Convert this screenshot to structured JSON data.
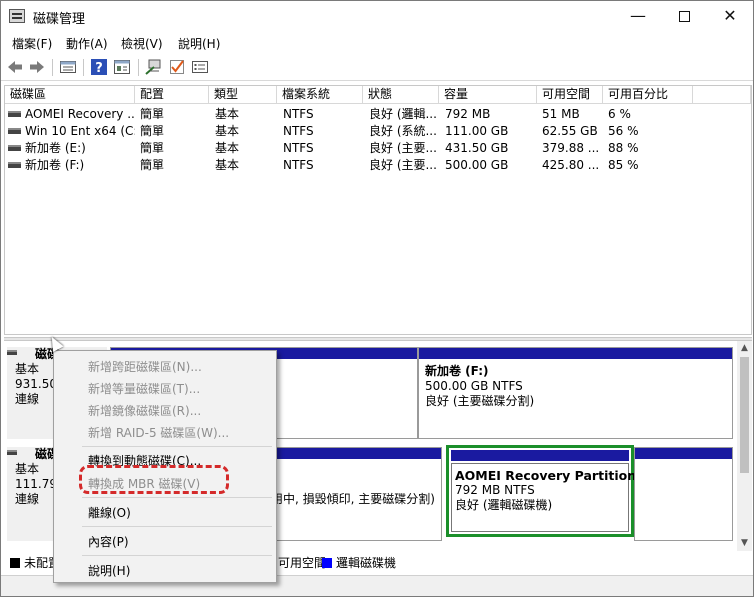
{
  "window": {
    "title": "磁碟管理",
    "minimize": "—",
    "close": "✕"
  },
  "menu": {
    "file": "檔案(F)",
    "action": "動作(A)",
    "view": "檢視(V)",
    "help": "說明(H)"
  },
  "toolbar": {
    "icons": [
      "back-icon",
      "forward-icon",
      "disk-list-icon",
      "help-icon",
      "properties-icon",
      "connect-icon",
      "checkmark-icon",
      "settings-list-icon"
    ]
  },
  "volume_table": {
    "headers": [
      "磁碟區",
      "配置",
      "類型",
      "檔案系統",
      "狀態",
      "容量",
      "可用空間",
      "可用百分比"
    ],
    "rows": [
      {
        "volume": "AOMEI Recovery ...",
        "layout": "簡單",
        "type": "基本",
        "fs": "NTFS",
        "status": "良好 (邏輯...",
        "capacity": "792 MB",
        "free": "51 MB",
        "pct": "6 %"
      },
      {
        "volume": "Win 10 Ent x64 (C:)",
        "layout": "簡單",
        "type": "基本",
        "fs": "NTFS",
        "status": "良好 (系統...",
        "capacity": "111.00 GB",
        "free": "62.55 GB",
        "pct": "56 %"
      },
      {
        "volume": "新加卷 (E:)",
        "layout": "簡單",
        "type": "基本",
        "fs": "NTFS",
        "status": "良好 (主要...",
        "capacity": "431.50 GB",
        "free": "379.88 ...",
        "pct": "88 %"
      },
      {
        "volume": "新加卷 (F:)",
        "layout": "簡單",
        "type": "基本",
        "fs": "NTFS",
        "status": "良好 (主要...",
        "capacity": "500.00 GB",
        "free": "425.80 ...",
        "pct": "85 %"
      }
    ]
  },
  "disks": [
    {
      "name": "磁碟",
      "type": "基本",
      "size": "931.50",
      "state": "連線"
    },
    {
      "name": "磁碟",
      "type": "基本",
      "size": "111.79",
      "state": "連線"
    }
  ],
  "partitions": {
    "f_drive": {
      "title": "新加卷  (F:)",
      "size": "500.00 GB NTFS",
      "status": "良好 (主要磁碟分割)"
    },
    "c_drive_text": "用中, 損毀傾印, 主要磁碟分割)",
    "aomei": {
      "title": "AOMEI Recovery Partition",
      "size": "792 MB NTFS",
      "status": "良好 (邏輯磁碟機)"
    }
  },
  "legend": {
    "unallocated": "未配置",
    "free_space": "可用空間",
    "logical": "邏輯磁碟機",
    "colors": {
      "unallocated": "#000000",
      "free_space": "#6fd06f",
      "logical": "#0000ff",
      "primary": "#1a1aa0",
      "selected": "#1b8f2a"
    }
  },
  "context_menu": {
    "items": [
      {
        "label": "新增跨距磁碟區(N)...",
        "enabled": false
      },
      {
        "label": "新增等量磁碟區(T)...",
        "enabled": false
      },
      {
        "label": "新增鏡像磁碟區(R)...",
        "enabled": false
      },
      {
        "label": "新增 RAID-5 磁碟區(W)...",
        "enabled": false
      },
      {
        "label": "轉換到動態磁碟(C)...",
        "enabled": true
      },
      {
        "label": "轉換成 MBR 磁碟(V)",
        "enabled": false
      },
      {
        "label": "離線(O)",
        "enabled": true
      },
      {
        "label": "內容(P)",
        "enabled": true
      },
      {
        "label": "說明(H)",
        "enabled": true
      }
    ]
  }
}
